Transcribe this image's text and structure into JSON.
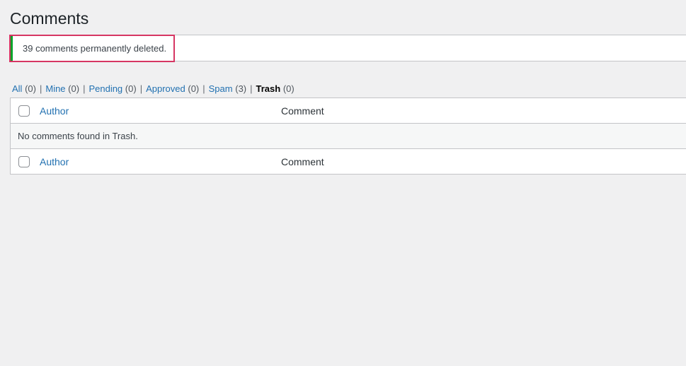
{
  "page": {
    "title": "Comments"
  },
  "notice": {
    "message": "39 comments permanently deleted.",
    "accent_color": "#00a32a",
    "highlight_color": "#d63663"
  },
  "filters": [
    {
      "label": "All",
      "count": "(0)",
      "current": false
    },
    {
      "label": "Mine",
      "count": "(0)",
      "current": false
    },
    {
      "label": "Pending",
      "count": "(0)",
      "current": false
    },
    {
      "label": "Approved",
      "count": "(0)",
      "current": false
    },
    {
      "label": "Spam",
      "count": "(3)",
      "current": false
    },
    {
      "label": "Trash",
      "count": "(0)",
      "current": true
    }
  ],
  "filter_separator": "|",
  "table": {
    "columns": {
      "author": "Author",
      "comment": "Comment"
    },
    "empty_message": "No comments found in Trash."
  }
}
